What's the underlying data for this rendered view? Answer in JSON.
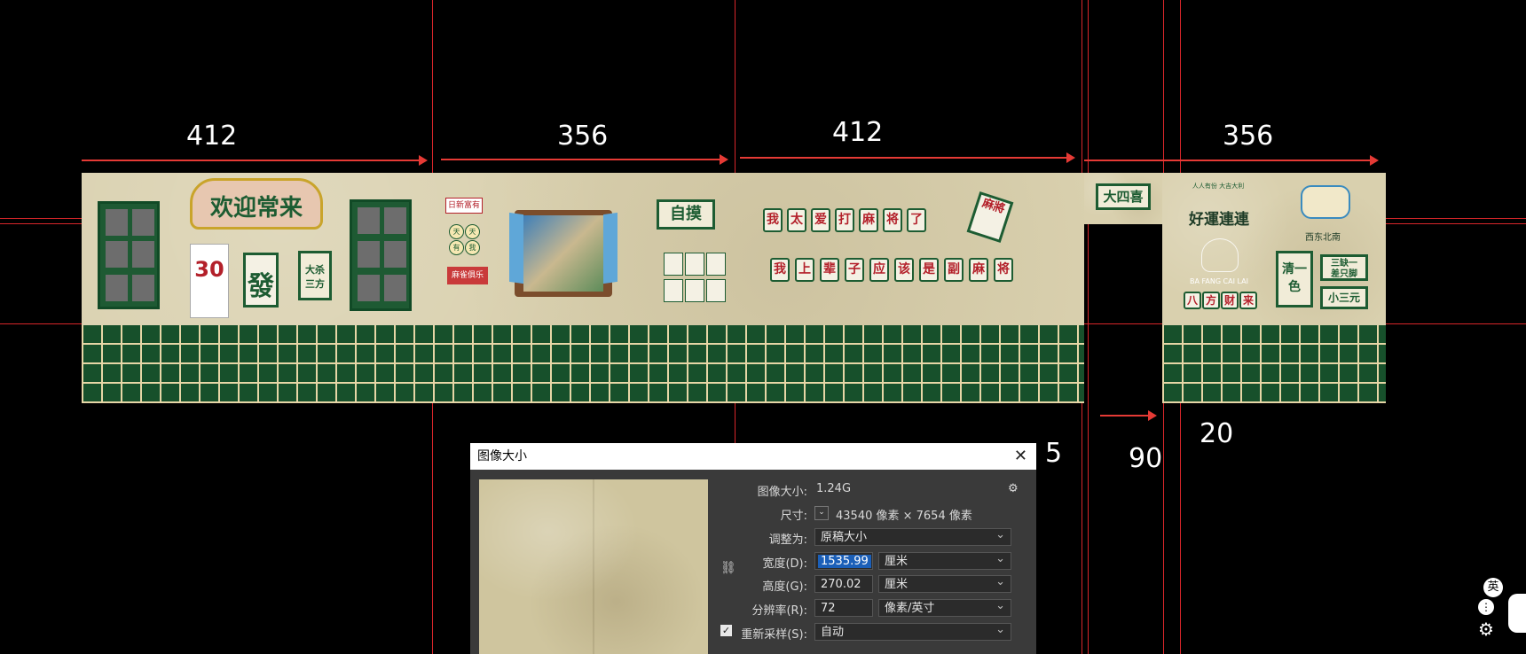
{
  "dimensions": {
    "d1": "412",
    "d2": "356",
    "d3": "412",
    "d4": "356",
    "d5": "5",
    "d6": "90",
    "d7": "20"
  },
  "artwork": {
    "welcome_sign": "欢迎常来",
    "calendar_day": "30",
    "fa_tile": "發",
    "left_plaque": [
      "大杀",
      "三方"
    ],
    "zimo_sign": "自摸",
    "left_note": "日新富有",
    "round_badges": [
      "天",
      "天",
      "有",
      "我"
    ],
    "red_tag": "麻雀俱乐",
    "line1_tiles": [
      "我",
      "太",
      "爱",
      "打",
      "麻",
      "将",
      "了"
    ],
    "line2_tiles": [
      "我",
      "上",
      "辈",
      "子",
      "应",
      "该",
      "是",
      "副",
      "麻",
      "将"
    ],
    "big_tile": "麻將",
    "dasixi_sign": "大四喜",
    "lucky_title": "好運連連",
    "small_arc_text": "人人有份 大吉大利",
    "fortune_sub": "BA FANG CAI LAI",
    "fortune_cn": [
      "八",
      "方",
      "财",
      "来"
    ],
    "mini_label": "西东北南",
    "qingyise": "清一色",
    "right_plaque_top": [
      "三缺一",
      "差只脚"
    ],
    "right_plaque_bottom": "小三元"
  },
  "dialog": {
    "title": "图像大小",
    "image_size_label": "图像大小:",
    "image_size_value": "1.24G",
    "dims_label": "尺寸:",
    "dims_value": "43540 像素 × 7654 像素",
    "fit_label": "调整为:",
    "fit_value": "原稿大小",
    "width_label": "宽度(D):",
    "width_value": "1535.99",
    "width_unit": "厘米",
    "height_label": "高度(G):",
    "height_value": "270.02",
    "height_unit": "厘米",
    "res_label": "分辨率(R):",
    "res_value": "72",
    "res_unit": "像素/英寸",
    "resample_label": "重新采样(S):",
    "resample_value": "自动"
  },
  "tray": {
    "ime": "英"
  },
  "colors": {
    "guide": "#d8262a",
    "tile_green": "#17502b",
    "wall_beige": "#d9d0ae"
  }
}
